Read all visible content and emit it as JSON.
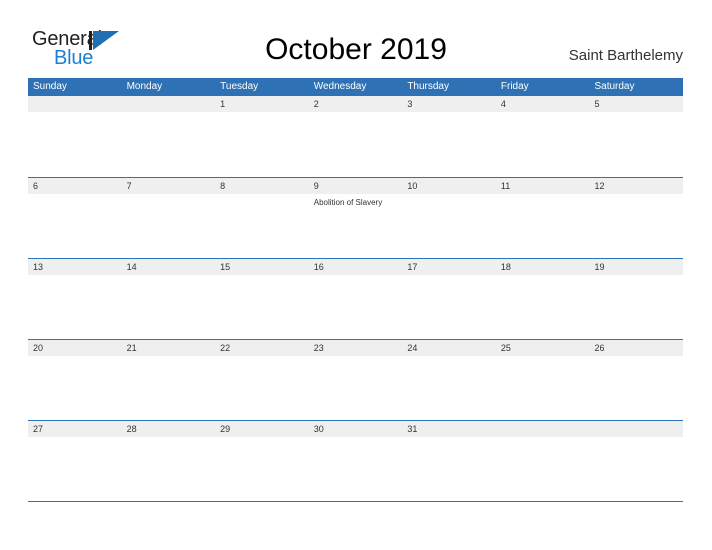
{
  "brand": {
    "word_one": "General",
    "word_two": "Blue"
  },
  "header": {
    "title": "October 2019",
    "location": "Saint Barthelemy"
  },
  "colors": {
    "header_blue": "#2E72B5",
    "band_gray": "#EFEFEF",
    "logo_blue": "#1B7FD4",
    "text_dark": "#333333"
  },
  "weekdays": [
    "Sunday",
    "Monday",
    "Tuesday",
    "Wednesday",
    "Thursday",
    "Friday",
    "Saturday"
  ],
  "weeks": [
    {
      "days": [
        {
          "date": "",
          "events": []
        },
        {
          "date": "",
          "events": []
        },
        {
          "date": "1",
          "events": []
        },
        {
          "date": "2",
          "events": []
        },
        {
          "date": "3",
          "events": []
        },
        {
          "date": "4",
          "events": []
        },
        {
          "date": "5",
          "events": []
        }
      ]
    },
    {
      "days": [
        {
          "date": "6",
          "events": []
        },
        {
          "date": "7",
          "events": []
        },
        {
          "date": "8",
          "events": []
        },
        {
          "date": "9",
          "events": [
            "Abolition of Slavery"
          ]
        },
        {
          "date": "10",
          "events": []
        },
        {
          "date": "11",
          "events": []
        },
        {
          "date": "12",
          "events": []
        }
      ]
    },
    {
      "days": [
        {
          "date": "13",
          "events": []
        },
        {
          "date": "14",
          "events": []
        },
        {
          "date": "15",
          "events": []
        },
        {
          "date": "16",
          "events": []
        },
        {
          "date": "17",
          "events": []
        },
        {
          "date": "18",
          "events": []
        },
        {
          "date": "19",
          "events": []
        }
      ]
    },
    {
      "days": [
        {
          "date": "20",
          "events": []
        },
        {
          "date": "21",
          "events": []
        },
        {
          "date": "22",
          "events": []
        },
        {
          "date": "23",
          "events": []
        },
        {
          "date": "24",
          "events": []
        },
        {
          "date": "25",
          "events": []
        },
        {
          "date": "26",
          "events": []
        }
      ]
    },
    {
      "days": [
        {
          "date": "27",
          "events": []
        },
        {
          "date": "28",
          "events": []
        },
        {
          "date": "29",
          "events": []
        },
        {
          "date": "30",
          "events": []
        },
        {
          "date": "31",
          "events": []
        },
        {
          "date": "",
          "events": []
        },
        {
          "date": "",
          "events": []
        }
      ]
    }
  ]
}
